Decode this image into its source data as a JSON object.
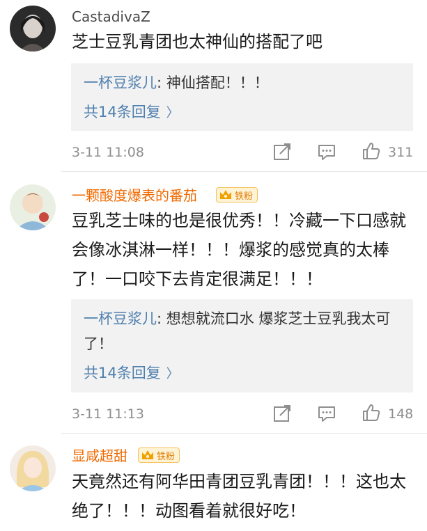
{
  "comments": [
    {
      "username": "CastadivaZ",
      "text": "芝士豆乳青团也太神仙的搭配了吧",
      "reply": {
        "user": "一杯豆浆儿",
        "sep": ":",
        "text": " 神仙搭配！！！",
        "more_label": "共14条回复"
      },
      "time": "3-11 11:08",
      "likes": "311"
    },
    {
      "username": "一颗酸度爆表的番茄",
      "badge": "铁粉",
      "text": "豆乳芝士味的也是很优秀！！冷藏一下口感就会像冰淇淋一样！！！爆浆的感觉真的太棒了！一口咬下去肯定很满足！！！",
      "reply": {
        "user": "一杯豆浆儿",
        "sep": ":",
        "text": " 想想就流口水 爆浆芝士豆乳我太可了！",
        "more_label": "共14条回复"
      },
      "time": "3-11 11:13",
      "likes": "148"
    },
    {
      "username": "显咸超甜",
      "badge": "铁粉",
      "text": "天竟然还有阿华田青团豆乳青团！！！这也太绝了！！！动图看着就很好吃！"
    }
  ],
  "icons": {
    "share": "share-icon",
    "comment": "comment-icon",
    "like": "thumbs-up-icon",
    "chevron": "chevron-right-icon",
    "crown": "crown-icon"
  },
  "colors": {
    "username_orange": "#f06a00",
    "reply_user_blue": "#4f7fae",
    "meta_gray": "#8e8e8e"
  }
}
